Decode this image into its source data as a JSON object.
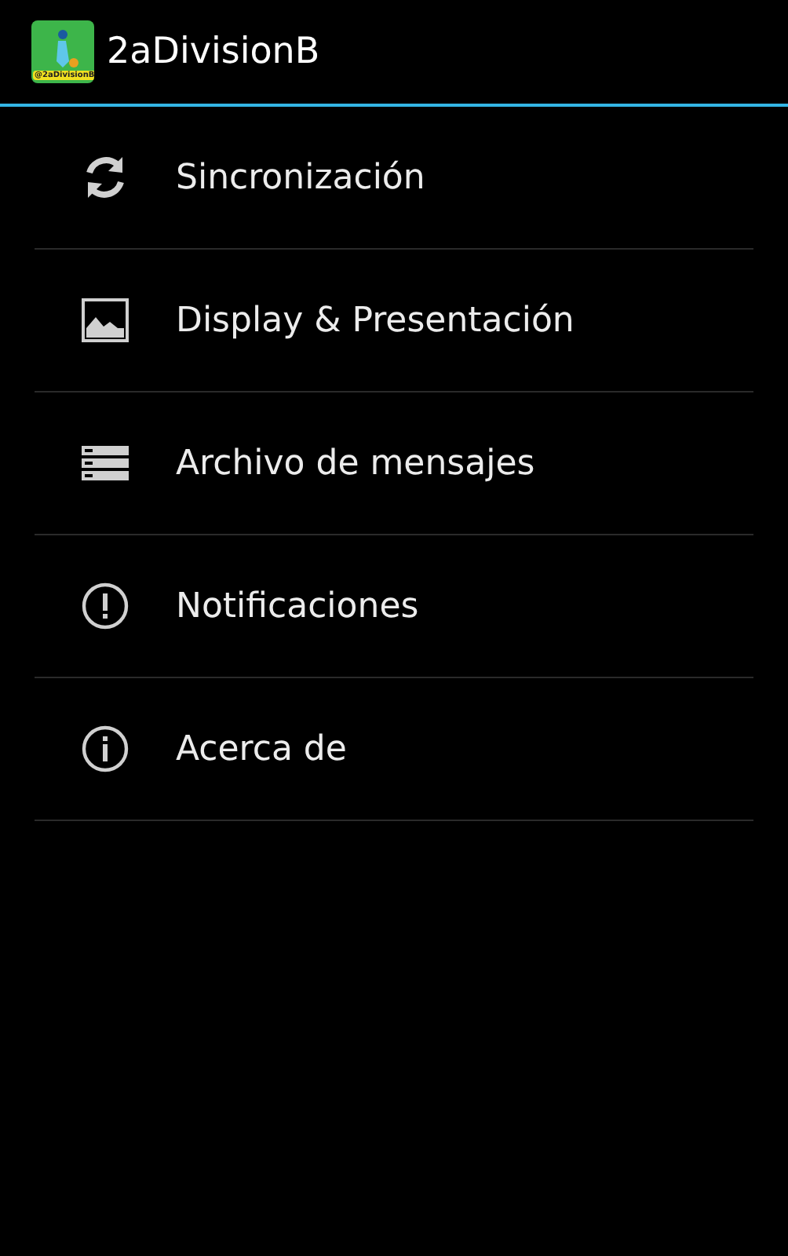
{
  "action_bar": {
    "logo_text": "@2aDivisionB",
    "title": "2aDivisionB"
  },
  "menu": [
    {
      "kind": "sync",
      "label": "Sincronización"
    },
    {
      "kind": "image",
      "label": "Display & Presentación"
    },
    {
      "kind": "archive",
      "label": "Archivo de mensajes"
    },
    {
      "kind": "alert",
      "label": "Notificaciones"
    },
    {
      "kind": "info",
      "label": "Acerca de"
    }
  ]
}
